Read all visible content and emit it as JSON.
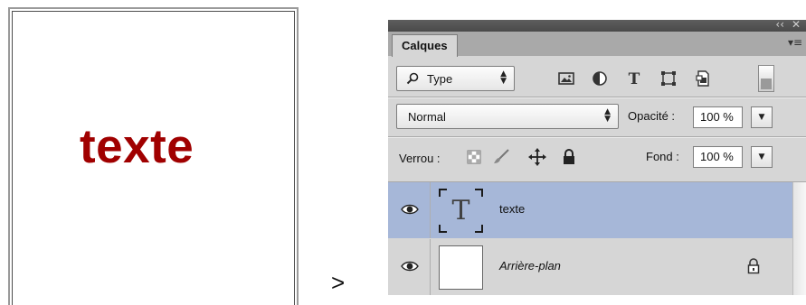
{
  "document": {
    "canvas_text": "texte",
    "text_color": "#a00000"
  },
  "arrow": ">",
  "panel": {
    "title_buttons": {
      "collapse": "‹‹",
      "close": "✕"
    },
    "tab": "Calques",
    "menu_icon": "panel-menu-icon",
    "filter": {
      "label": "Type",
      "icon": "search-icon"
    },
    "filter_icons": [
      "image-filter-icon",
      "adjustment-filter-icon",
      "type-filter-icon",
      "shape-filter-icon",
      "smart-object-filter-icon"
    ],
    "filter_toggle": "filter-toggle",
    "blend_mode": "Normal",
    "opacity": {
      "label": "Opacité :",
      "value": "100 %"
    },
    "lock": {
      "label": "Verrou :",
      "icons": [
        "lock-transparent-icon",
        "lock-brush-icon",
        "lock-move-icon",
        "lock-all-icon"
      ]
    },
    "fill": {
      "label": "Fond :",
      "value": "100 %"
    },
    "layers": [
      {
        "name": "texte",
        "kind": "type",
        "selected": true,
        "visible": true
      },
      {
        "name": "Arrière-plan",
        "kind": "background",
        "selected": false,
        "visible": true,
        "locked": true
      }
    ],
    "colors": {
      "selection": "#a6b7d8",
      "panel": "#d6d6d6"
    }
  }
}
